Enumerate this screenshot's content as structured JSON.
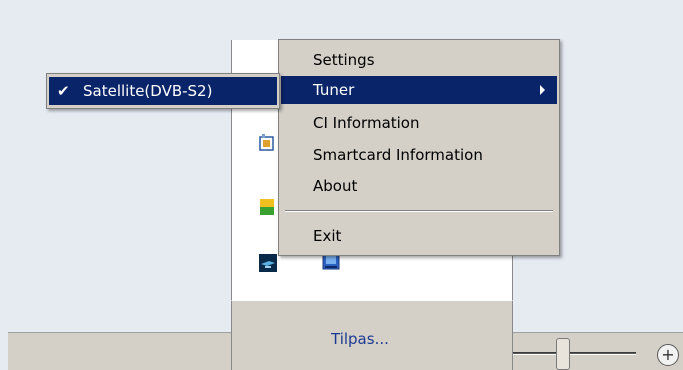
{
  "menu": {
    "items": [
      {
        "label": "Settings"
      },
      {
        "label": "Tuner"
      },
      {
        "label": "CI Information"
      },
      {
        "label": "Smartcard Information"
      },
      {
        "label": "About"
      },
      {
        "label": "Exit"
      }
    ],
    "selected_index": 1
  },
  "submenu": {
    "items": [
      {
        "label": "Satellite(DVB-S2)",
        "checked": true
      }
    ],
    "check_glyph": "✔"
  },
  "tray": {
    "customize_label": "Tilpas...",
    "icons": [
      "app-icon",
      "app-icon",
      "app-icon",
      "app-icon"
    ]
  },
  "statusbar": {
    "zoom_in_glyph": "+"
  },
  "colors": {
    "menu_bg": "#d4d0c8",
    "highlight": "#0a246a",
    "link": "#1c3a94"
  }
}
